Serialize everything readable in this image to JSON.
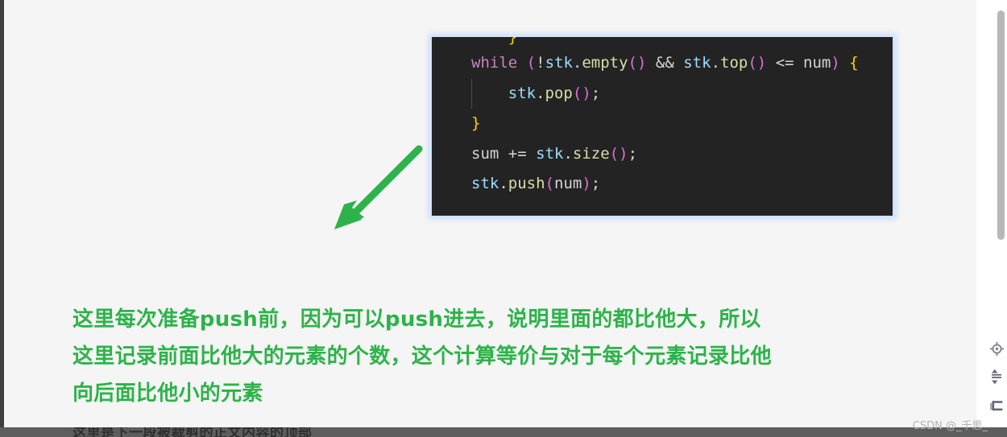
{
  "page": {
    "background_color": "#f5f5f5",
    "watermark": "CSDN @_千思_"
  },
  "code_block": {
    "background_color": "#232323",
    "language": "cpp",
    "selection_glow_color": "#cfe2fb",
    "lines": [
      {
        "id": "line-partial-top",
        "text": "}",
        "tokens": [
          {
            "text": "    }",
            "class": "tok-brace"
          }
        ]
      },
      {
        "id": "line-while",
        "text": "while (!stk.empty() && stk.top() <= num) {",
        "tokens": [
          {
            "text": "while",
            "class": "tok-kw"
          },
          {
            "text": " ",
            "class": "tok-plain"
          },
          {
            "text": "(",
            "class": "tok-paren"
          },
          {
            "text": "!",
            "class": "tok-plain"
          },
          {
            "text": "stk",
            "class": "tok-id"
          },
          {
            "text": ".",
            "class": "tok-plain"
          },
          {
            "text": "empty",
            "class": "tok-fn"
          },
          {
            "text": "()",
            "class": "tok-paren"
          },
          {
            "text": " ",
            "class": "tok-plain"
          },
          {
            "text": "&&",
            "class": "tok-plain"
          },
          {
            "text": " ",
            "class": "tok-plain"
          },
          {
            "text": "stk",
            "class": "tok-id"
          },
          {
            "text": ".",
            "class": "tok-plain"
          },
          {
            "text": "top",
            "class": "tok-fn"
          },
          {
            "text": "()",
            "class": "tok-paren"
          },
          {
            "text": " ",
            "class": "tok-plain"
          },
          {
            "text": "<=",
            "class": "tok-plain"
          },
          {
            "text": " ",
            "class": "tok-plain"
          },
          {
            "text": "num",
            "class": "tok-plain"
          },
          {
            "text": ")",
            "class": "tok-paren"
          },
          {
            "text": " ",
            "class": "tok-plain"
          },
          {
            "text": "{",
            "class": "tok-brace"
          }
        ]
      },
      {
        "id": "line-pop",
        "text": "    stk.pop();",
        "indent_guide": true,
        "tokens": [
          {
            "text": "    ",
            "class": "tok-plain"
          },
          {
            "text": "stk",
            "class": "tok-id"
          },
          {
            "text": ".",
            "class": "tok-plain"
          },
          {
            "text": "pop",
            "class": "tok-fn"
          },
          {
            "text": "()",
            "class": "tok-paren"
          },
          {
            "text": ";",
            "class": "tok-plain"
          }
        ]
      },
      {
        "id": "line-close-brace",
        "text": "}",
        "tokens": [
          {
            "text": "}",
            "class": "tok-brace"
          }
        ]
      },
      {
        "id": "line-sum",
        "text": "sum += stk.size();",
        "tokens": [
          {
            "text": "sum",
            "class": "tok-plain"
          },
          {
            "text": " ",
            "class": "tok-plain"
          },
          {
            "text": "+=",
            "class": "tok-plain"
          },
          {
            "text": " ",
            "class": "tok-plain"
          },
          {
            "text": "stk",
            "class": "tok-id"
          },
          {
            "text": ".",
            "class": "tok-plain"
          },
          {
            "text": "size",
            "class": "tok-fn"
          },
          {
            "text": "()",
            "class": "tok-paren"
          },
          {
            "text": ";",
            "class": "tok-plain"
          }
        ]
      },
      {
        "id": "line-push",
        "text": "stk.push(num);",
        "tokens": [
          {
            "text": "stk",
            "class": "tok-id"
          },
          {
            "text": ".",
            "class": "tok-plain"
          },
          {
            "text": "push",
            "class": "tok-fn"
          },
          {
            "text": "(",
            "class": "tok-paren"
          },
          {
            "text": "num",
            "class": "tok-plain"
          },
          {
            "text": ")",
            "class": "tok-paren"
          },
          {
            "text": ";",
            "class": "tok-plain"
          }
        ]
      }
    ]
  },
  "annotation": {
    "color": "#2db34a",
    "lines": [
      "这里每次准备push前，因为可以push进去，说明里面的都比他大，所以",
      "这里记录前面比他大的元素的个数，这个计算等价与对于每个元素记录比他",
      "向后面比他小的元素"
    ],
    "full_text": "这里每次准备push前，因为可以push进去，说明里面的都比他大，所以这里记录前面比他大的元素的个数，这个计算等价与对于每个元素记录比他向后面比他小的元素"
  },
  "arrow": {
    "color": "#2db34a",
    "direction": "down-left"
  },
  "bottom_partial_text": "这里是下一段被裁剪的正文内容的顶部",
  "side_icons": [
    {
      "name": "crosshair-icon",
      "label": "定位"
    },
    {
      "name": "sort-updown-icon",
      "label": "上下切换"
    },
    {
      "name": "window-icon",
      "label": "窗口"
    }
  ],
  "scrollbar": {
    "thumb_color": "#b8b8b8",
    "track_color": "#ffffff"
  }
}
